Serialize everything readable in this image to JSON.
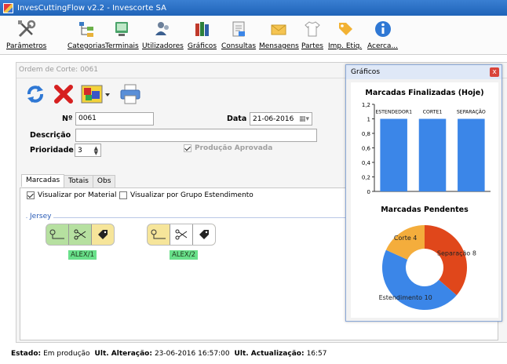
{
  "window": {
    "title": "InvesCuttingFlow v2.2 - Invescorte SA"
  },
  "toolbar": {
    "items": [
      {
        "label": "Parâmetros",
        "icon": "tools-icon"
      },
      {
        "label": "Categorias",
        "icon": "hierarchy-icon"
      },
      {
        "label": "Terminais",
        "icon": "terminal-icon"
      },
      {
        "label": "Utilizadores",
        "icon": "users-icon"
      },
      {
        "label": "Gráficos",
        "icon": "books-icon"
      },
      {
        "label": "Consultas",
        "icon": "report-icon"
      },
      {
        "label": "Mensagens",
        "icon": "envelope-icon"
      },
      {
        "label": "Partes",
        "icon": "shirt-icon"
      },
      {
        "label": "Imp. Etiq.",
        "icon": "tag-icon"
      },
      {
        "label": "Acerca...",
        "icon": "info-icon"
      }
    ]
  },
  "form": {
    "title": "Ordem de Corte: 0061",
    "numero_label": "Nº",
    "numero_value": "0061",
    "data_label": "Data",
    "data_value": "21-06-2016",
    "descricao_label": "Descrição",
    "descricao_value": "",
    "prioridade_label": "Prioridade",
    "prioridade_value": "3",
    "producao_aprovada_label": "Produção Aprovada",
    "tabs": [
      "Marcadas",
      "Totais",
      "Obs"
    ],
    "visualizar_material_label": "Visualizar por Material",
    "visualizar_grupo_label": "Visualizar por Grupo Estendimento",
    "group_title": "Jersey",
    "marcas": [
      {
        "label": "ALEX/1",
        "color": "#b6e0a0"
      },
      {
        "label": "ALEX/2",
        "color": "#f6e59a"
      }
    ]
  },
  "status": {
    "estado_label": "Estado:",
    "estado_value": "Em produção",
    "ult_alteracao_label": "Ult. Alteração:",
    "ult_alteracao_value": "23-06-2016 16:57:00",
    "ult_actualizacao_label": "Ult. Actualização:",
    "ult_actualizacao_value": "16:57"
  },
  "graficos": {
    "panel_title": "Gráficos",
    "close_label": "x",
    "bar_title": "Marcadas Finalizadas (Hoje)",
    "pie_title": "Marcadas Pendentes"
  },
  "chart_data": [
    {
      "type": "bar",
      "title": "Marcadas Finalizadas (Hoje)",
      "categories": [
        "ESTENDEDOR1",
        "CORTE1",
        "SEPARAÇÃO"
      ],
      "values": [
        1,
        1,
        1
      ],
      "ylim": [
        0,
        1.2
      ],
      "yticks": [
        "0",
        "0,2",
        "0,4",
        "0,6",
        "0,8",
        "1",
        "1,2"
      ],
      "color": "#3b86e8"
    },
    {
      "type": "pie",
      "title": "Marcadas Pendentes",
      "slices": [
        {
          "label": "Separação 8",
          "value": 8,
          "color": "#e0471b"
        },
        {
          "label": "Estendimento 10",
          "value": 10,
          "color": "#3b86e8"
        },
        {
          "label": "Corte 4",
          "value": 4,
          "color": "#f4ad3c"
        }
      ]
    }
  ]
}
